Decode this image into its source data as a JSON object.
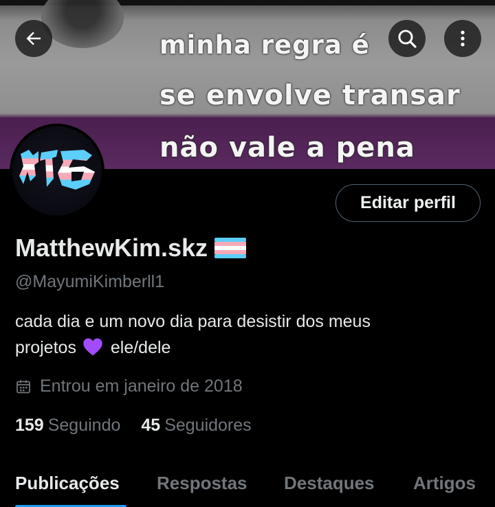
{
  "banner": {
    "lines": [
      "minha regra é",
      "se envolve transar",
      "não vale a pena"
    ]
  },
  "header": {
    "back_icon": "arrow-left-icon",
    "search_icon": "search-icon",
    "more_icon": "more-vertical-icon"
  },
  "profile": {
    "avatar_icon": "trans-flag-logo",
    "edit_label": "Editar perfil",
    "display_name": "MatthewKim.skz",
    "name_badge_icon": "transgender-flag-icon",
    "handle": "@MayumiKimberll1",
    "bio_line1": "cada dia e um novo dia para desistir dos meus",
    "bio_line2_before": "projetos",
    "bio_emoji_icon": "purple-heart-icon",
    "bio_line2_after": "ele/dele",
    "joined_icon": "calendar-icon",
    "joined": "Entrou em janeiro de 2018"
  },
  "stats": [
    {
      "count": "159",
      "label": "Seguindo"
    },
    {
      "count": "45",
      "label": "Seguidores"
    }
  ],
  "tabs": [
    {
      "label": "Publicações",
      "active": true
    },
    {
      "label": "Respostas",
      "active": false
    },
    {
      "label": "Destaques",
      "active": false
    },
    {
      "label": "Artigos",
      "active": false
    }
  ],
  "colors": {
    "background": "#000000",
    "text_primary": "#e7e9ea",
    "text_secondary": "#71767b",
    "accent": "#1d9bf0",
    "flag_blue": "#5bcefa",
    "flag_pink": "#f5a9b8",
    "heart_purple": "#a24cff"
  }
}
